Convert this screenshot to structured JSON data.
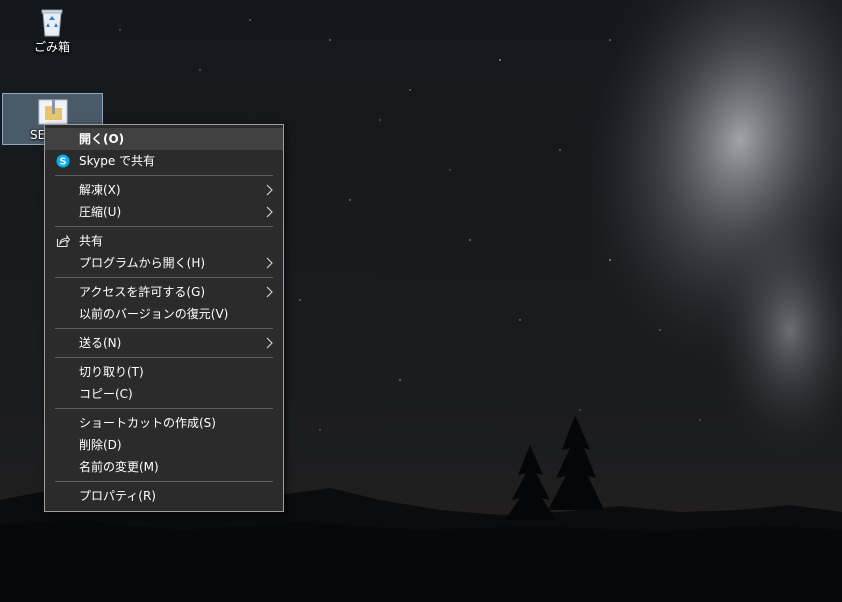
{
  "desktop": {
    "icons": [
      {
        "label": "ごみ箱",
        "icon": "recycle-bin-icon"
      },
      {
        "label": "SEC",
        "icon": "zip-folder-icon"
      }
    ]
  },
  "context_menu": {
    "items": [
      {
        "label": "開く(O)",
        "default": true,
        "highlighted": true
      },
      {
        "label": "Skype で共有",
        "icon": "skype-icon"
      },
      {
        "separator": true
      },
      {
        "label": "解凍(X)",
        "submenu": true
      },
      {
        "label": "圧縮(U)",
        "submenu": true
      },
      {
        "separator": true
      },
      {
        "label": "共有",
        "icon": "share-icon"
      },
      {
        "label": "プログラムから開く(H)",
        "submenu": true
      },
      {
        "separator": true
      },
      {
        "label": "アクセスを許可する(G)",
        "submenu": true
      },
      {
        "label": "以前のバージョンの復元(V)"
      },
      {
        "separator": true
      },
      {
        "label": "送る(N)",
        "submenu": true
      },
      {
        "separator": true
      },
      {
        "label": "切り取り(T)"
      },
      {
        "label": "コピー(C)"
      },
      {
        "separator": true
      },
      {
        "label": "ショートカットの作成(S)"
      },
      {
        "label": "削除(D)"
      },
      {
        "label": "名前の変更(M)"
      },
      {
        "separator": true
      },
      {
        "label": "プロパティ(R)"
      }
    ]
  },
  "colors": {
    "menu_bg": "#2b2b2b",
    "menu_border": "#a0a0a0",
    "menu_hover": "#414141",
    "skype_blue": "#00aff0",
    "sunset_orange": "#e07a1f"
  }
}
